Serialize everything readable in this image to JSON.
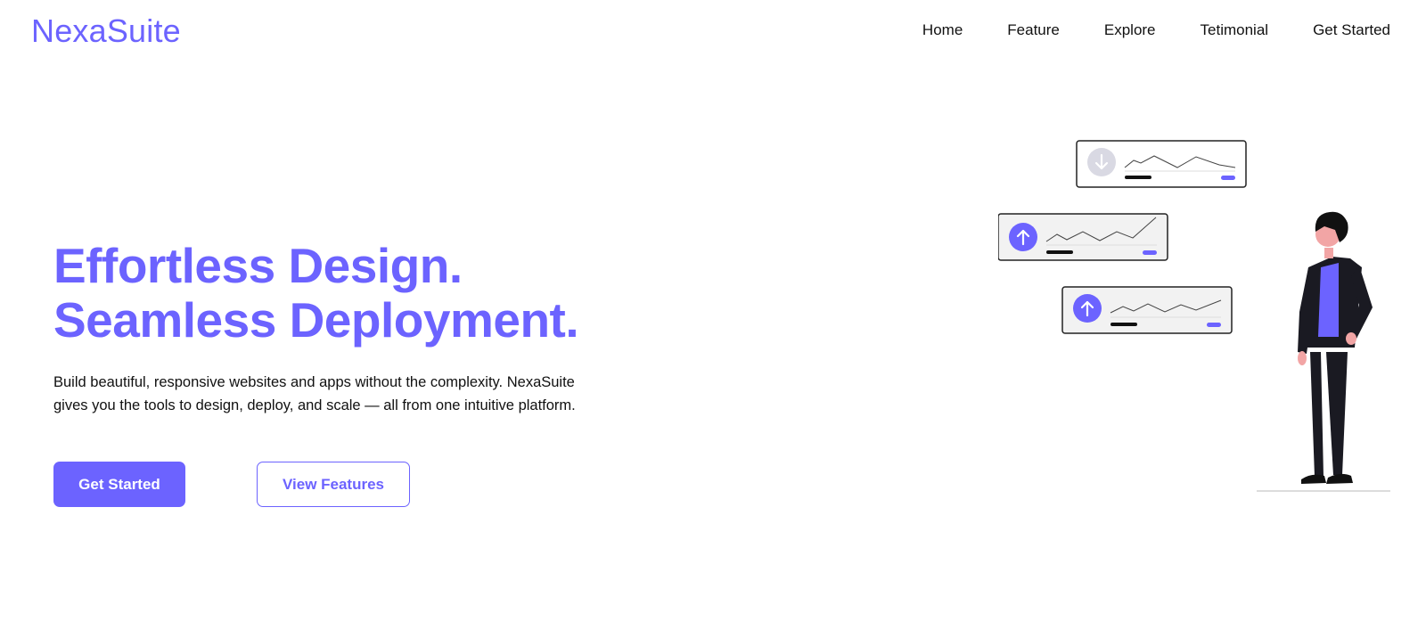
{
  "brand": {
    "name": "NexaSuite",
    "accent_color": "#6c63ff"
  },
  "nav": {
    "items": [
      {
        "label": "Home"
      },
      {
        "label": "Feature"
      },
      {
        "label": "Explore"
      },
      {
        "label": "Tetimonial"
      },
      {
        "label": "Get Started"
      }
    ]
  },
  "hero": {
    "headline_line1": "Effortless Design.",
    "headline_line2": "Seamless Deployment.",
    "description": "Build beautiful, responsive websites and apps without the complexity. NexaSuite gives you the tools to design, deploy, and scale — all from one intuitive platform.",
    "primary_button": "Get Started",
    "secondary_button": "View Features"
  },
  "illustration": {
    "cards": [
      {
        "icon": "arrow-down-icon",
        "state": "inactive"
      },
      {
        "icon": "arrow-up-icon",
        "state": "active"
      },
      {
        "icon": "arrow-up-icon",
        "state": "active"
      }
    ],
    "figure": "person-standing"
  }
}
